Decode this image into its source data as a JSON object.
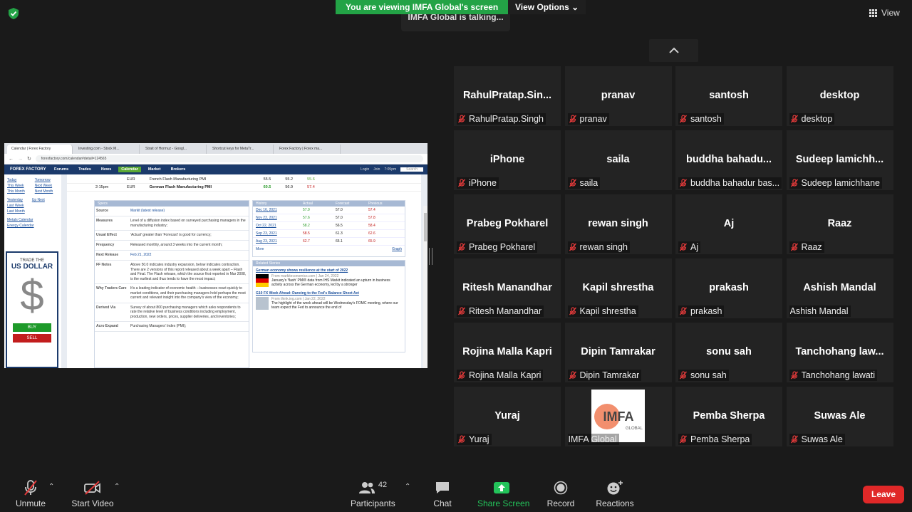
{
  "top": {
    "share_banner": "You are viewing IMFA Global's screen",
    "view_options": "View Options ⌄",
    "talking": "IMFA Global is talking...",
    "view": "View"
  },
  "colors": {
    "accent_green": "#23a346",
    "leave_red": "#e02828",
    "mic_off_red": "#e23a3a"
  },
  "participants": [
    {
      "big": "RahulPratap.Sin...",
      "label": "RahulPratap.Singh",
      "muted": true
    },
    {
      "big": "pranav",
      "label": "pranav",
      "muted": true
    },
    {
      "big": "santosh",
      "label": "santosh",
      "muted": true
    },
    {
      "big": "desktop",
      "label": "desktop",
      "muted": true
    },
    {
      "big": "iPhone",
      "label": "iPhone",
      "muted": true
    },
    {
      "big": "saila",
      "label": "saila",
      "muted": true
    },
    {
      "big": "buddha  bahadu...",
      "label": "buddha bahadur bas...",
      "muted": true
    },
    {
      "big": "Sudeep  lamichh...",
      "label": "Sudeep lamichhane",
      "muted": true
    },
    {
      "big": "Prabeg Pokharel",
      "label": "Prabeg Pokharel",
      "muted": true
    },
    {
      "big": "rewan singh",
      "label": "rewan singh",
      "muted": true
    },
    {
      "big": "Aj",
      "label": "Aj",
      "muted": true
    },
    {
      "big": "Raaz",
      "label": "Raaz",
      "muted": true
    },
    {
      "big": "Ritesh Manandhar",
      "label": "Ritesh Manandhar",
      "muted": true
    },
    {
      "big": "Kapil shrestha",
      "label": "Kapil shrestha",
      "muted": true
    },
    {
      "big": "prakash",
      "label": "prakash",
      "muted": true
    },
    {
      "big": "Ashish Mandal",
      "label": "Ashish Mandal",
      "muted": false
    },
    {
      "big": "Rojina Malla Kapri",
      "label": "Rojina Malla Kapri",
      "muted": true
    },
    {
      "big": "Dipin Tamrakar",
      "label": "Dipin Tamrakar",
      "muted": true
    },
    {
      "big": "sonu sah",
      "label": "sonu sah",
      "muted": true
    },
    {
      "big": "Tanchohang  law...",
      "label": "Tanchohang lawati",
      "muted": true
    },
    {
      "big": "Yuraj",
      "label": "Yuraj",
      "muted": true
    },
    {
      "big": "",
      "label": "IMFA Global",
      "muted": false,
      "logo": "IMFA",
      "logo_sub": "GLOBAL"
    },
    {
      "big": "Pemba Sherpa",
      "label": "Pemba Sherpa",
      "muted": true
    },
    {
      "big": "Suwas Ale",
      "label": "Suwas Ale",
      "muted": true
    }
  ],
  "screen": {
    "tabs": [
      "Calendar | Forex Factory",
      "Investing.com - Stock M...",
      "Strait of Hormuz - Googl...",
      "Shortcut keys for MetaTr...",
      "Forex Factory | Forex ma..."
    ],
    "address": "forexfactory.com/calendar#detail=124565",
    "nav": [
      "Forums",
      "Trades",
      "News",
      "Calendar",
      "Market",
      "Brokers"
    ],
    "nav_right": [
      "Login",
      "Join",
      "7:05pm",
      "Search"
    ],
    "logo": "FOREX FACTORY",
    "left_links": [
      "Today",
      "Tomorrow",
      "This Week",
      "Next Week",
      "This Month",
      "Next Month",
      "Yesterday",
      "Up Next",
      "Last Week",
      "Last Month",
      "Metals Calendar",
      "Energy Calendar"
    ],
    "ad": {
      "trade": "TRADE THE",
      "currency": "US DOLLAR",
      "symbol": "$",
      "buy": "BUY",
      "sell": "SELL"
    },
    "events": [
      {
        "time": "",
        "cur": "EUR",
        "name": "French Flash Manufacturing PMI",
        "actual": "55.5",
        "forecast": "55.2",
        "previous": "55.6"
      },
      {
        "time": "2:15pm",
        "cur": "EUR",
        "name": "German Flash Manufacturing PMI",
        "actual": "60.5",
        "forecast": "56.9",
        "previous": "57.4"
      }
    ],
    "specs_header": "Specs",
    "specs": [
      {
        "k": "Source",
        "v": "Markit (latest release)"
      },
      {
        "k": "Measures",
        "v": "Level of a diffusion index based on surveyed purchasing managers in the manufacturing industry;"
      },
      {
        "k": "Usual Effect",
        "v": "'Actual' greater than 'Forecast' is good for currency;"
      },
      {
        "k": "Frequency",
        "v": "Released monthly, around 3 weeks into the current month;"
      },
      {
        "k": "Next Release",
        "v": "Feb 21, 2022"
      },
      {
        "k": "FF Notes",
        "v": "Above 50.0 indicates industry expansion, below indicates contraction. There are 2 versions of this report released about a week apart – Flash and Final. The Flash release, which the source first reported in Mar 2008, is the earliest and thus tends to have the most impact;"
      },
      {
        "k": "Why Traders Care",
        "v": "It's a leading indicator of economic health – businesses react quickly to market conditions, and their purchasing managers hold perhaps the most current and relevant insight into the company's view of the economy;"
      },
      {
        "k": "Derived Via",
        "v": "Survey of about 800 purchasing managers which asks respondents to rate the relative level of business conditions including employment, production, new orders, prices, supplier deliveries, and inventories;"
      },
      {
        "k": "Acro Expand",
        "v": "Purchasing Managers' Index (PMI);"
      }
    ],
    "history_header": [
      "History",
      "Actual",
      "Forecast",
      "Previous"
    ],
    "history": [
      [
        "Dec 16, 2021",
        "57.9",
        "57.0",
        "57.4"
      ],
      [
        "Nov 23, 2021",
        "57.6",
        "57.0",
        "57.8"
      ],
      [
        "Oct 22, 2021",
        "58.2",
        "56.5",
        "58.4"
      ],
      [
        "Sep 23, 2021",
        "58.5",
        "61.3",
        "62.6"
      ],
      [
        "Aug 23, 2021",
        "62.7",
        "65.1",
        "65.9"
      ]
    ],
    "history_more": "More",
    "history_graph": "Graph",
    "news_header": "Related Stories",
    "news": [
      {
        "title": "German economy shows resilience at the start of 2022",
        "src": "From markiteconomics.com | Jan 24, 2022",
        "text": "January's 'flash' PMI® data from IHS Markit indicated an upturn in business activity across the German economy, led by a stronger"
      },
      {
        "title": "G10 FX Week Ahead: Dancing to the Fed's Balance Sheet Act",
        "src": "From think.ing.com | Jan 22, 2022",
        "text": "The highlight of the week ahead will be Wednesday's FOMC meeting, where our team expect the Fed to announce the end of"
      }
    ]
  },
  "toolbar": {
    "unmute": "Unmute",
    "start_video": "Start Video",
    "participants": "Participants",
    "participants_count": "42",
    "chat": "Chat",
    "share_screen": "Share Screen",
    "record": "Record",
    "reactions": "Reactions",
    "leave": "Leave"
  }
}
